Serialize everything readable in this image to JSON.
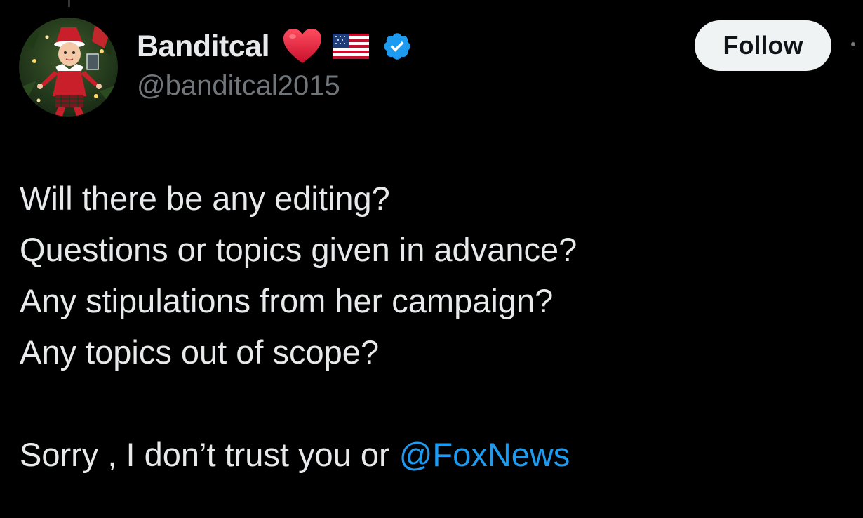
{
  "author": {
    "display_name": "Banditcal",
    "handle": "@banditcal2015",
    "avatar": "elf-on-the-shelf-avatar",
    "badges": [
      "heart-icon",
      "us-flag-icon",
      "verified-icon"
    ]
  },
  "actions": {
    "follow_label": "Follow"
  },
  "tweet": {
    "lines": [
      "Will there be any editing?",
      "Questions or topics given in advance?",
      "Any stipulations from her campaign?",
      "Any topics out of scope?"
    ],
    "closing_text": "Sorry , I don’t trust you or ",
    "mention": "@FoxNews"
  },
  "colors": {
    "background": "#000000",
    "text_primary": "#e7e9ea",
    "text_secondary": "#71767b",
    "link": "#1d9bf0",
    "verified": "#1d9bf0",
    "heart": "#e0182d",
    "follow_bg": "#eff3f4",
    "follow_text": "#0f1419"
  }
}
